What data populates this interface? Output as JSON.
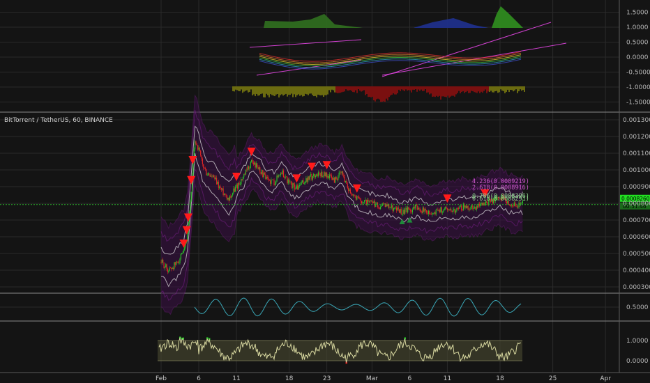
{
  "symbol_title": "BitTorrent / TetherUS, 60, BINANCE",
  "colors": {
    "background": "#141414",
    "grid": "#2a2a2a",
    "pane_separator": "#8a8a8a",
    "candle_up": "#27c427",
    "candle_down": "#e02626",
    "band_outer": "#7a1f8a",
    "band_inner": "#e6e6e6",
    "sell_marker": "#ff1a1a",
    "buy_marker": "#1f8a3a",
    "fib_label": "#d05ad0",
    "last_price_label": "#22e022",
    "oscillator_line": "#3aa8b8",
    "rsi_zone": "#4a4a30",
    "trend_line": "#d040d0"
  },
  "chart_data": [
    {
      "pane": "top-indicator",
      "type": "area",
      "y_ticks": [
        "1.5000",
        "1.0000",
        "0.5000",
        "0.0000",
        "-0.5000",
        "-1.0000",
        "-1.5000"
      ],
      "ylim": [
        -1.75,
        1.75
      ],
      "series": [
        {
          "color": "green",
          "x_start": "Feb 10",
          "x_end": "Feb 25",
          "level": 1.25
        },
        {
          "color": "blue",
          "x_start": "Mar 8",
          "x_end": "Mar 15",
          "level": 1.15
        },
        {
          "color": "green",
          "x_start": "Mar 16",
          "x_end": "Mar 21",
          "level": 1.7
        }
      ]
    },
    {
      "pane": "price",
      "type": "line",
      "title": "BitTorrent / TetherUS, 60, BINANCE",
      "y_ticks": [
        "0.0013000",
        "0.0012000",
        "0.0011000",
        "0.0010000",
        "0.0009000",
        "0.0008000",
        "0.0007000",
        "0.0006000",
        "0.0005000",
        "0.0004000",
        "0.0003000"
      ],
      "ylim": [
        0.00028,
        0.00132
      ],
      "x_ticks": [
        "Feb",
        "6",
        "11",
        "18",
        "23",
        "Mar",
        "6",
        "11",
        "18",
        "25",
        "Apr"
      ],
      "x_day_index": [
        0,
        5,
        10,
        17,
        22,
        28,
        33,
        38,
        45,
        52,
        59
      ],
      "price_series_day": [
        0,
        1,
        2,
        3,
        3.5,
        4,
        4.5,
        5,
        5.5,
        6,
        7,
        8,
        9,
        10,
        11,
        12,
        13,
        14,
        15,
        16,
        17,
        18,
        19,
        20,
        21,
        22,
        23,
        24,
        25,
        26,
        27,
        28,
        29,
        30,
        31,
        32,
        33,
        34,
        35,
        36,
        37,
        38,
        39,
        40,
        41,
        42,
        43,
        44,
        45,
        46,
        47,
        48
      ],
      "price_series": [
        0.00045,
        0.0004,
        0.00044,
        0.0005,
        0.0006,
        0.00088,
        0.00118,
        0.00112,
        0.00103,
        0.00098,
        0.00095,
        0.00088,
        0.00083,
        0.0009,
        0.00096,
        0.00105,
        0.00101,
        0.00094,
        0.00093,
        0.00099,
        0.00092,
        0.00089,
        0.00093,
        0.00096,
        0.00098,
        0.00097,
        0.00094,
        0.00098,
        0.00088,
        0.00083,
        0.00081,
        0.0008,
        0.00078,
        0.00079,
        0.00077,
        0.00075,
        0.00076,
        0.00078,
        0.00075,
        0.00074,
        0.00076,
        0.00077,
        0.00076,
        0.00078,
        0.00077,
        0.00078,
        0.0008,
        0.00082,
        0.00084,
        0.00081,
        0.00079,
        0.0008
      ],
      "sell_markers_day": [
        3,
        3.4,
        3.6,
        4,
        4.2,
        10,
        12,
        18,
        20,
        22,
        26,
        38,
        43
      ],
      "buy_markers_day": [
        32,
        33
      ],
      "fib_levels": [
        {
          "label": "4.236(0.0009219)"
        },
        {
          "label": "2.618(0.0008916)"
        },
        {
          "label": "0.786(0.0008396)"
        },
        {
          "label": "0.618(0.0008291)"
        }
      ],
      "last_price_label": "0.0008260",
      "countdown_label": "00:51:46"
    },
    {
      "pane": "oscillator",
      "type": "line",
      "y_ticks": [
        "0.5000"
      ],
      "ylim": [
        0.0,
        1.0
      ]
    },
    {
      "pane": "rsi",
      "type": "line",
      "y_ticks": [
        "1.0000",
        "0.0000"
      ],
      "ylim": [
        -0.3,
        1.3
      ],
      "zone": [
        0.0,
        1.0
      ]
    }
  ]
}
